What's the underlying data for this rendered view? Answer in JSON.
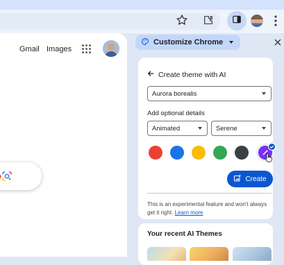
{
  "toolbar": {
    "bookmark_icon": "star-outline-icon",
    "extensions_icon": "puzzle-icon",
    "side_panel_icon": "side-panel-icon",
    "menu_icon": "three-dots-vertical-icon"
  },
  "google_page": {
    "gmail_link": "Gmail",
    "images_link": "Images",
    "apps_icon": "grid-dots-icon",
    "lens_icon": "google-lens-icon"
  },
  "side_panel": {
    "header_chip": "Customize Chrome",
    "header_icon": "palette-icon",
    "close_icon": "close-icon",
    "create_theme": {
      "back_label": "Create theme with AI",
      "subject": "Aurora borealis",
      "optional_label": "Add optional details",
      "style": "Animated",
      "mood": "Serene",
      "colors": [
        "#e94235",
        "#1a73e8",
        "#fbbc04",
        "#34a853",
        "#3c4043",
        "#7b2ff7"
      ],
      "selected_color_index": 5,
      "create_button": "Create",
      "disclaimer": "This is an experimental feature and won't always get it right.",
      "learn_more": "Learn more"
    },
    "recent": {
      "title": "Your recent AI Themes"
    }
  },
  "colors": {
    "accent": "#0b57d0",
    "chip_bg": "#c2d7fb",
    "panel_bg": "#dfe7f5"
  }
}
